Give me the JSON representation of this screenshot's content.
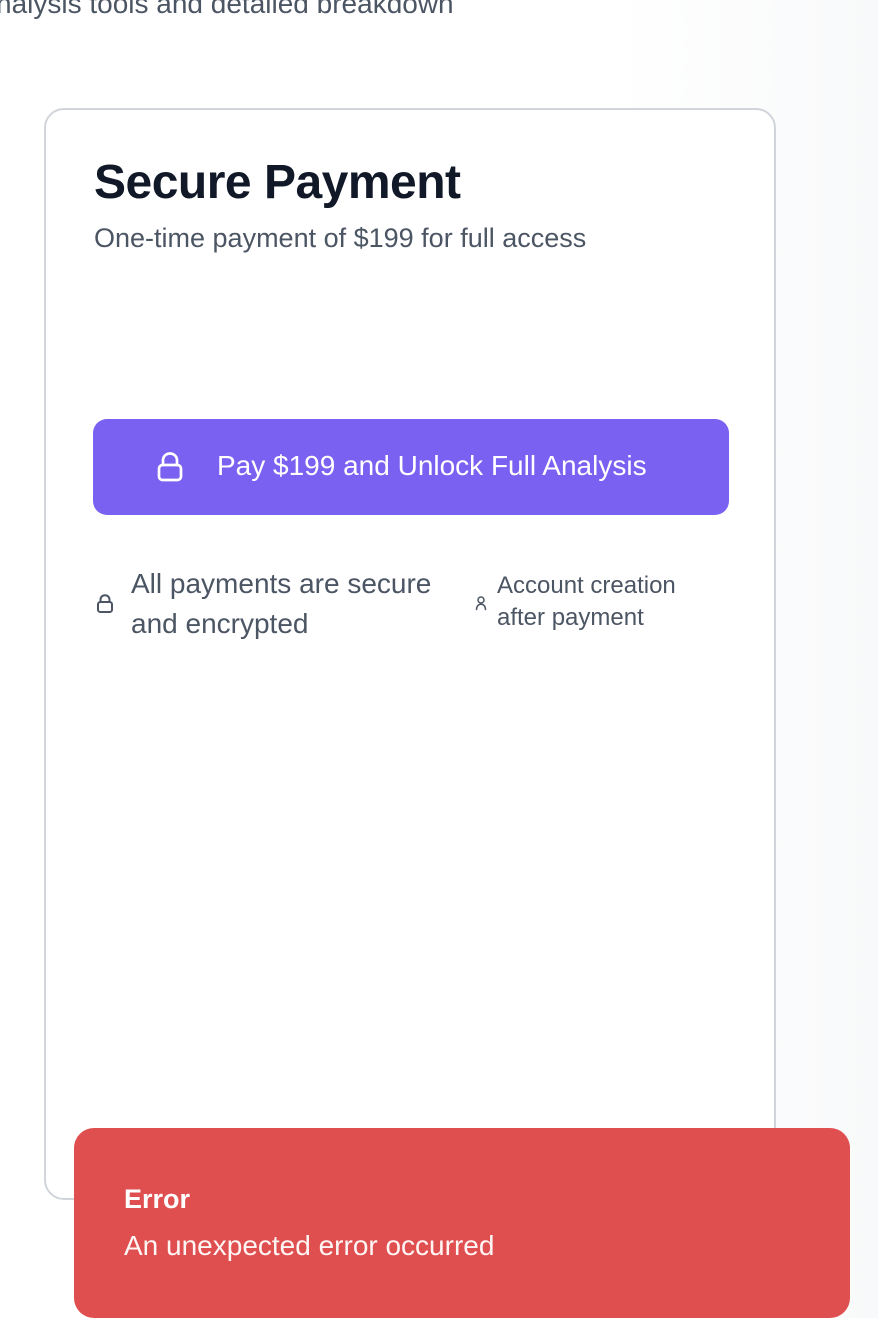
{
  "page": {
    "top_fragment": "nalysis tools and detailed breakdown"
  },
  "payment_card": {
    "title": "Secure Payment",
    "subtitle": "One-time payment of $199 for full access",
    "button_label": "Pay $199 and Unlock Full Analysis",
    "button_icon": "lock-icon",
    "info": {
      "secure_icon": "lock-icon",
      "secure_text": "All payments are secure and encrypted",
      "account_icon": "user-icon",
      "account_text": "Account creation after payment"
    },
    "accent_color": "#7b61f1"
  },
  "toast": {
    "title": "Error",
    "message": "An unexpected error occurred",
    "color": "#df4f4f"
  }
}
